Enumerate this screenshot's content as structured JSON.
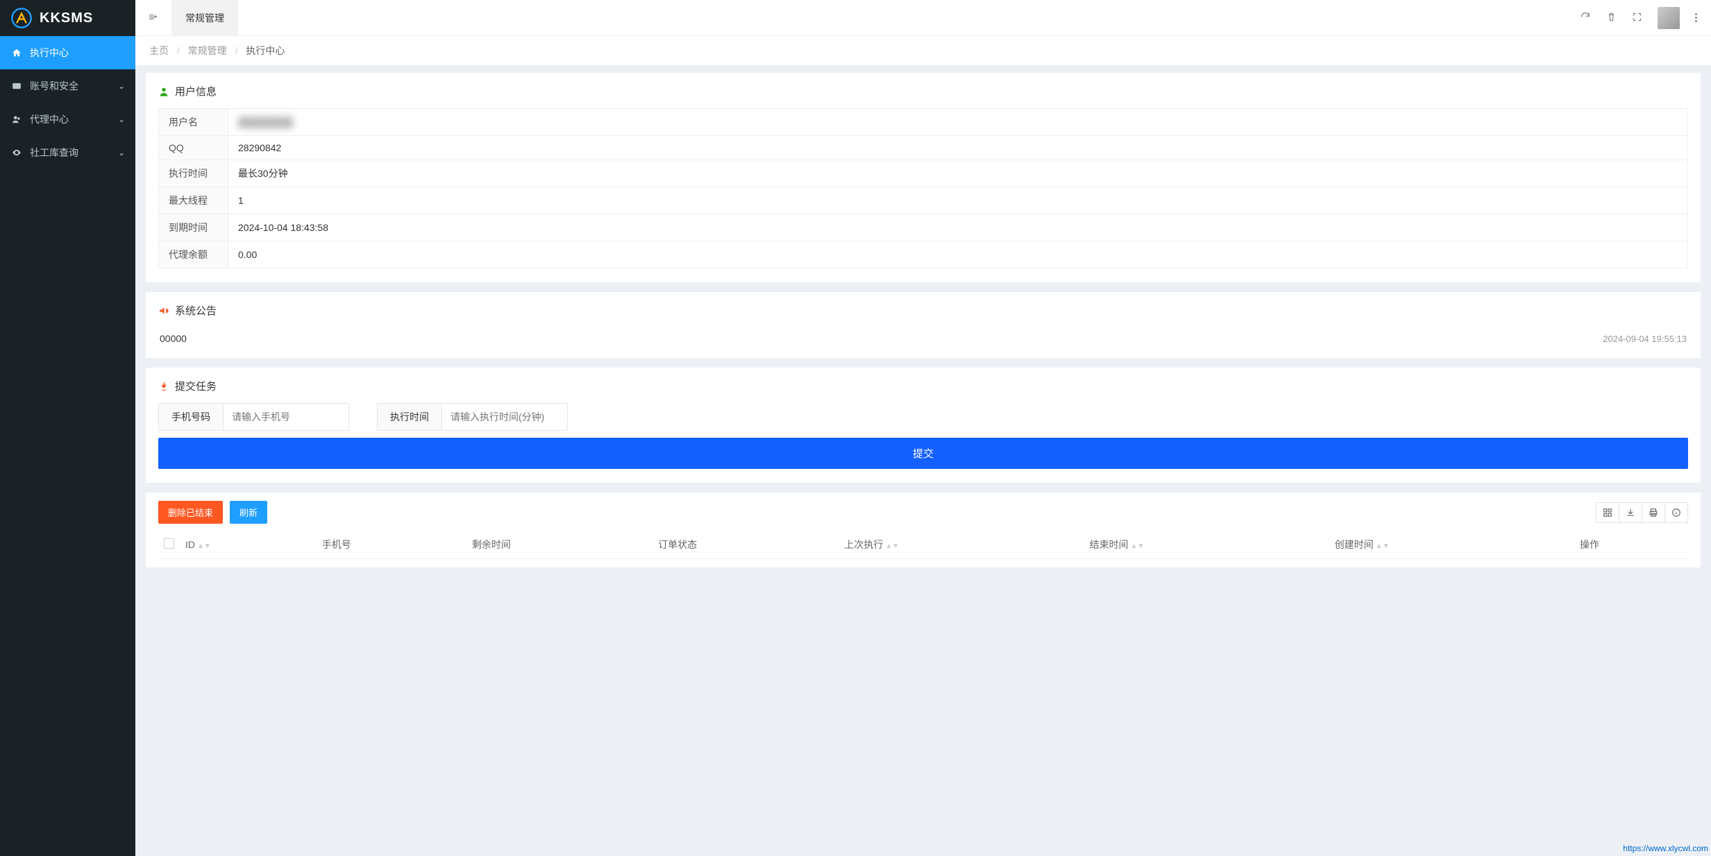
{
  "brand": "KKSMS",
  "sidebar": {
    "items": [
      {
        "label": "执行中心",
        "active": true
      },
      {
        "label": "账号和安全",
        "expandable": true
      },
      {
        "label": "代理中心",
        "expandable": true
      },
      {
        "label": "社工库查询",
        "expandable": true
      }
    ]
  },
  "tab": {
    "label": "常规管理"
  },
  "breadcrumb": {
    "home": "主页",
    "mid": "常规管理",
    "current": "执行中心"
  },
  "panels": {
    "user_info_title": "用户信息",
    "announcement_title": "系统公告",
    "submit_task_title": "提交任务"
  },
  "user_info": {
    "rows": [
      {
        "key": "用户名",
        "value": "",
        "blurred": true
      },
      {
        "key": "QQ",
        "value": "28290842"
      },
      {
        "key": "执行时间",
        "value": "最长30分钟"
      },
      {
        "key": "最大线程",
        "value": "1"
      },
      {
        "key": "到期时间",
        "value": "2024-10-04 18:43:58"
      },
      {
        "key": "代理余额",
        "value": "0.00"
      }
    ]
  },
  "announcement": {
    "text": "00000",
    "time": "2024-09-04 19:55:13"
  },
  "task_form": {
    "phone_label": "手机号码",
    "phone_placeholder": "请输入手机号",
    "duration_label": "执行时间",
    "duration_placeholder": "请输入执行时间(分钟)",
    "submit_label": "提交"
  },
  "table_actions": {
    "delete_finished": "删除已结束",
    "refresh": "刷新"
  },
  "table_columns": [
    "ID",
    "手机号",
    "剩余时间",
    "订单状态",
    "上次执行",
    "结束时间",
    "创建时间",
    "操作"
  ],
  "footer_url": "https://www.xlycwl.com"
}
